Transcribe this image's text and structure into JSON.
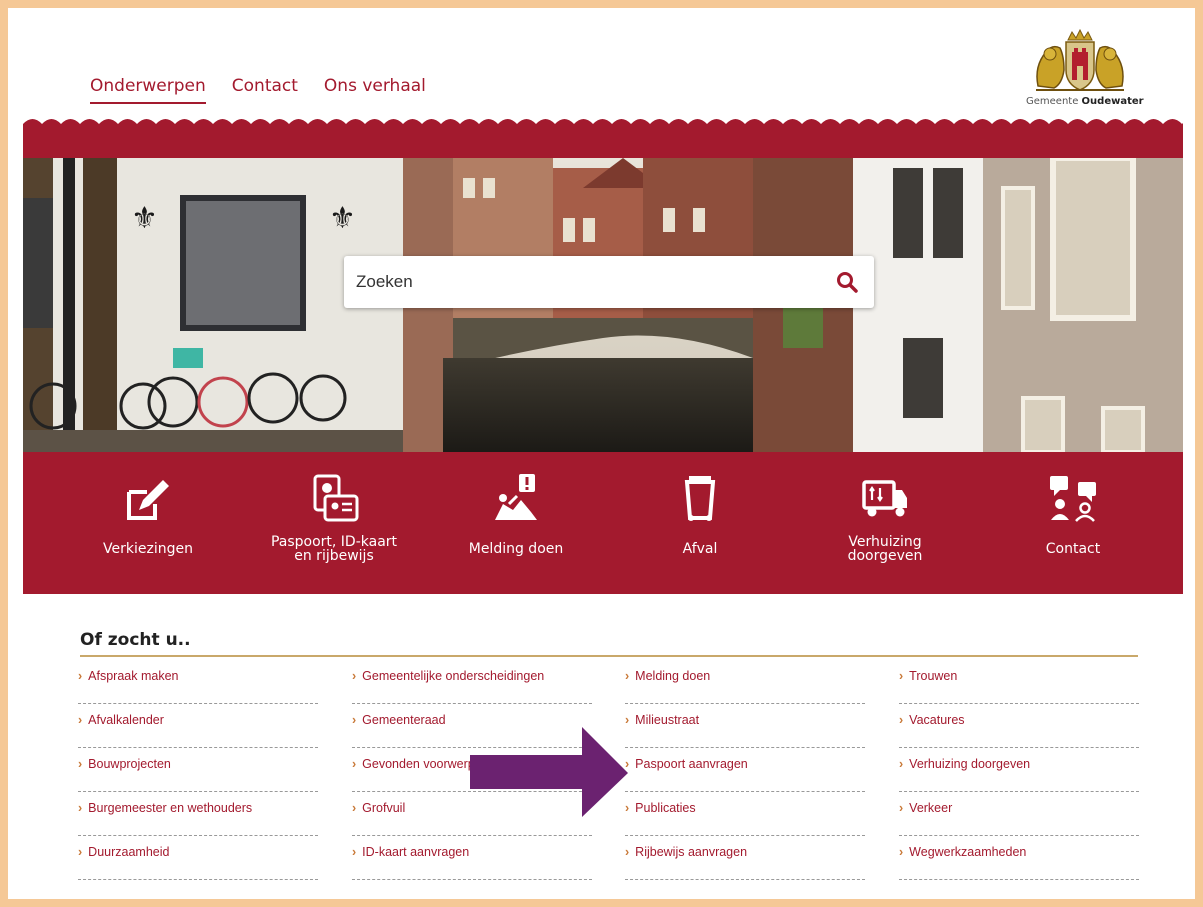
{
  "header": {
    "nav": [
      {
        "label": "Onderwerpen",
        "active": true
      },
      {
        "label": "Contact",
        "active": false
      },
      {
        "label": "Ons verhaal",
        "active": false
      }
    ],
    "logo": {
      "prefix": "Gemeente ",
      "name": "Oudewater"
    }
  },
  "search": {
    "placeholder": "Zoeken"
  },
  "quick_links": [
    {
      "label_lines": [
        "Verkiezingen"
      ],
      "icon": "pencil-edit-icon"
    },
    {
      "label_lines": [
        "Paspoort, ID-kaart",
        "en rijbewijs"
      ],
      "icon": "id-card-icon"
    },
    {
      "label_lines": [
        "Melding doen"
      ],
      "icon": "report-issue-icon"
    },
    {
      "label_lines": [
        "Afval"
      ],
      "icon": "waste-bin-icon"
    },
    {
      "label_lines": [
        "Verhuizing",
        "doorgeven"
      ],
      "icon": "moving-truck-icon"
    },
    {
      "label_lines": [
        "Contact"
      ],
      "icon": "chat-people-icon"
    }
  ],
  "of_zocht_u": {
    "title": "Of zocht u..",
    "columns": [
      [
        "Afspraak maken",
        "Afvalkalender",
        "Bouwprojecten",
        "Burgemeester en wethouders",
        "Duurzaamheid"
      ],
      [
        "Gemeentelijke onderscheidingen",
        "Gemeenteraad",
        "Gevonden voorwerpen",
        "Grofvuil",
        "ID-kaart aanvragen"
      ],
      [
        "Melding doen",
        "Milieustraat",
        "Paspoort aanvragen",
        "Publicaties",
        "Rijbewijs aanvragen"
      ],
      [
        "Trouwen",
        "Vacatures",
        "Verhuizing doorgeven",
        "Verkeer",
        "Wegwerkzaamheden"
      ]
    ]
  },
  "colors": {
    "brand": "#a31a2e",
    "accent": "#c9a86a",
    "frame": "#f5c896",
    "annotation_arrow": "#6b2270"
  }
}
